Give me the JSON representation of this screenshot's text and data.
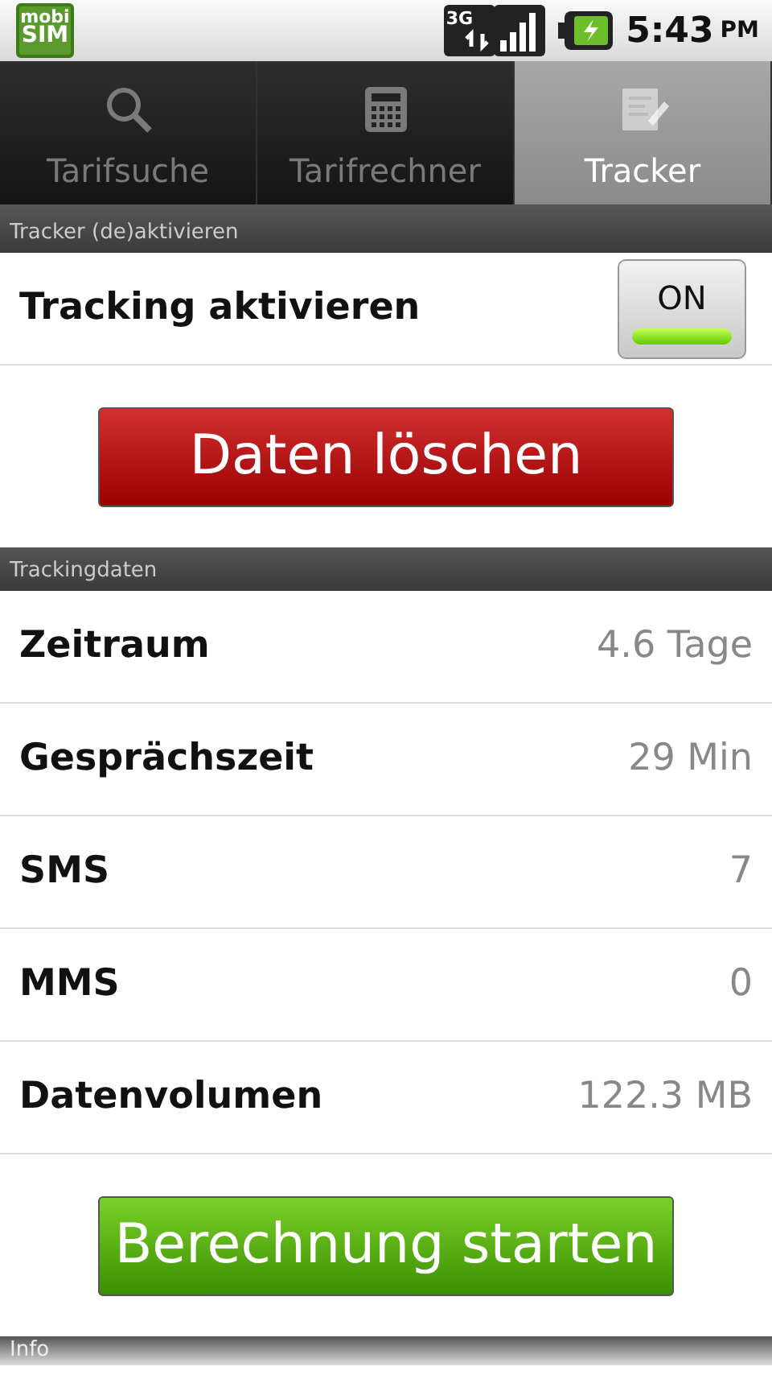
{
  "status_bar": {
    "logo": [
      "mobi",
      "SIM"
    ],
    "time": "5:43",
    "ampm": "PM",
    "network": "3G"
  },
  "tabs": [
    {
      "label": "Tarifsuche",
      "kind": "search",
      "selected": false
    },
    {
      "label": "Tarifrechner",
      "kind": "calculator",
      "selected": false
    },
    {
      "label": "Tracker",
      "kind": "notepad",
      "selected": true
    }
  ],
  "tracker_section": {
    "header": "Tracker (de)aktivieren",
    "toggle": {
      "label": "Tracking aktivieren",
      "state_text": "ON",
      "on": true
    },
    "delete_button": "Daten löschen"
  },
  "tracking_data": {
    "header": "Trackingdaten",
    "rows": [
      {
        "label": "Zeitraum",
        "value": "4.6 Tage"
      },
      {
        "label": "Gesprächszeit",
        "value": "29 Min"
      },
      {
        "label": "SMS",
        "value": "7"
      },
      {
        "label": "MMS",
        "value": "0"
      },
      {
        "label": "Datenvolumen",
        "value": "122.3 MB"
      }
    ],
    "start_button": "Berechnung starten"
  },
  "info_header": "Info"
}
